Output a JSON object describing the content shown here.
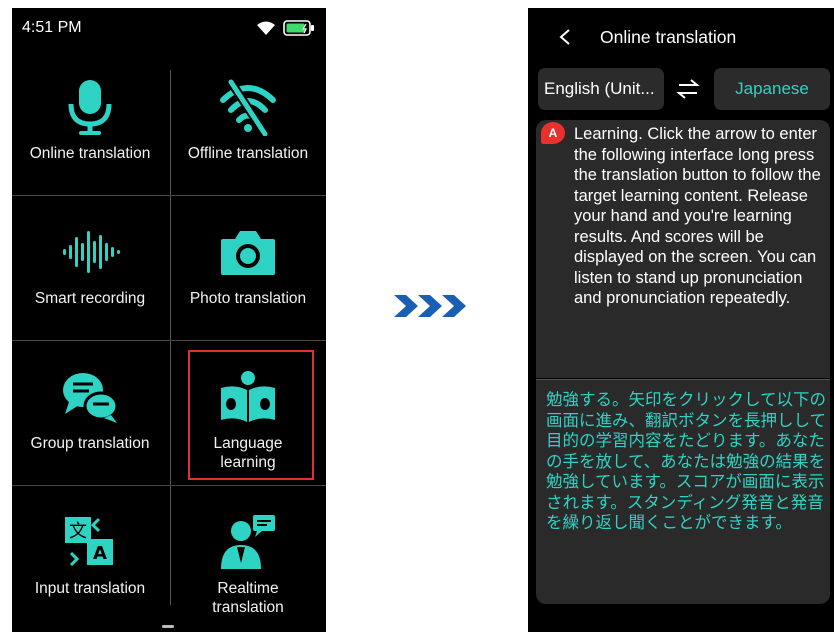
{
  "left_screen": {
    "status_time": "4:51 PM",
    "tiles": [
      {
        "label": "Online translation",
        "icon": "microphone-icon"
      },
      {
        "label": "Offline translation",
        "icon": "no-signal-icon"
      },
      {
        "label": "Smart recording",
        "icon": "sound-wave-icon"
      },
      {
        "label": "Photo translation",
        "icon": "camera-icon"
      },
      {
        "label": "Group translation",
        "icon": "chat-bubbles-icon"
      },
      {
        "label": "Language learning",
        "icon": "reading-person-icon",
        "highlighted": true
      },
      {
        "label": "Input translation",
        "icon": "translate-icon"
      },
      {
        "label": "Realtime translation",
        "icon": "presenter-icon"
      }
    ]
  },
  "right_screen": {
    "title": "Online translation",
    "source_language": "English (Unit...",
    "target_language": "Japanese",
    "speaker_badge": "A",
    "source_text": "Learning. Click the arrow to enter the following interface long press the translation button to follow the target learning content. Release your hand and you're learning results. And scores will be displayed on the screen. You can listen to stand up pronunciation and pronunciation repeatedly.",
    "target_text": "勉強する。矢印をクリックして以下の画面に進み、翻訳ボタンを長押しして目的の学習内容をたどります。あなたの手を放して、あなたは勉強の結果を勉強しています。スコアが画面に表示されます。スタンディング発音と発音を繰り返し聞くことができます。"
  },
  "colors": {
    "accent_teal": "#2fd3c4",
    "highlight_red": "#e0322d",
    "arrow_blue": "#1a5fb4",
    "battery_green": "#3ddc6a"
  }
}
